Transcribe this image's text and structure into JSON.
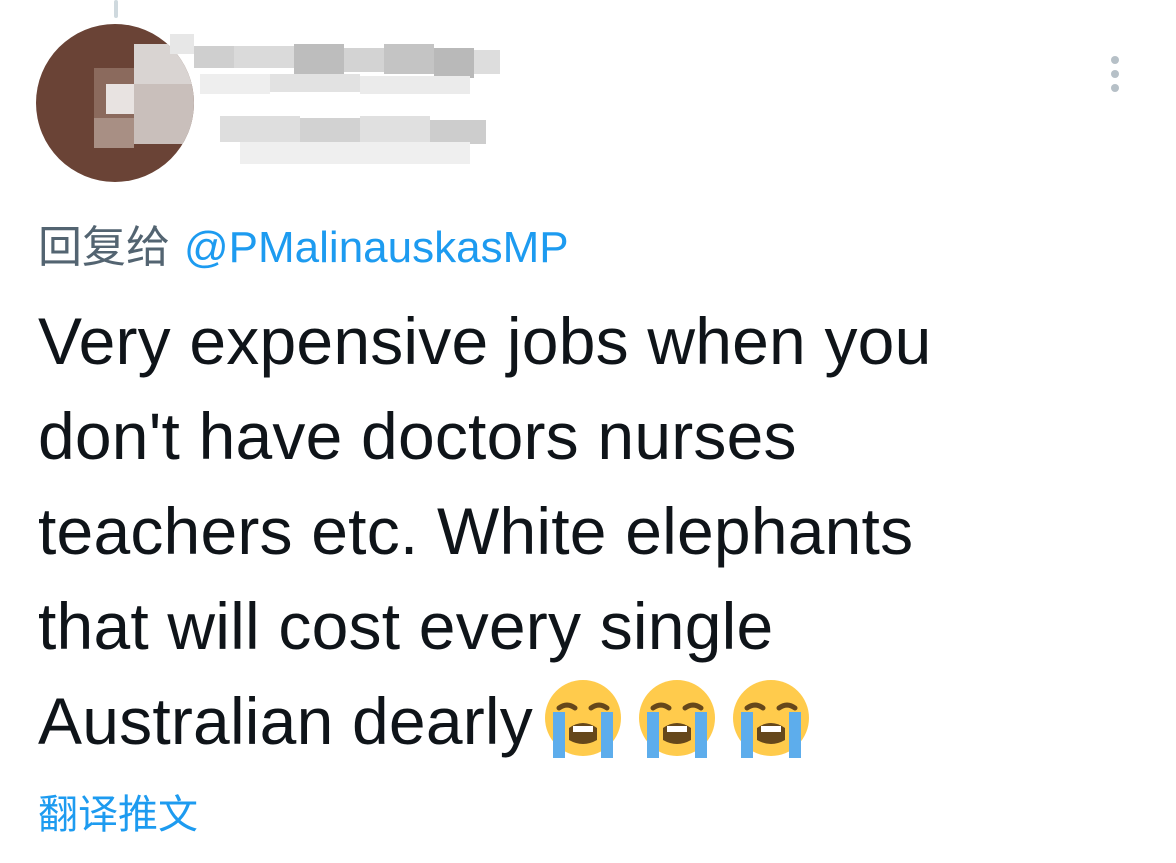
{
  "tweet": {
    "reply_prefix": "回复给",
    "reply_to_handle": "@PMalinauskasMP",
    "text_lines": [
      "Very expensive jobs when you",
      "don't have doctors nurses",
      "teachers etc. White elephants",
      "that will cost every single",
      "Australian dearly"
    ],
    "emojis": [
      "loudly-crying-face-icon",
      "loudly-crying-face-icon",
      "loudly-crying-face-icon"
    ],
    "translate_label": "翻译推文"
  },
  "author": {
    "avatar": "blurred-avatar",
    "name_state": "pixelated"
  },
  "menu": {
    "icon": "more-vertical-icon"
  },
  "colors": {
    "link": "#1d9bf0",
    "secondary_text": "#536471",
    "primary_text": "#0f1419",
    "avatar_bg": "#6a4336"
  }
}
